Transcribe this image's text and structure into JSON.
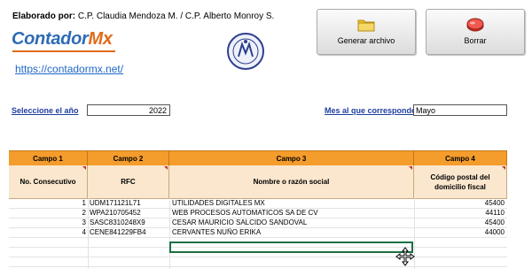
{
  "header": {
    "elaborado_label": "Elaborado por:",
    "elaborado_text": " C.P. Claudia Mendoza M. / C.P. Alberto Monroy S.",
    "logo_part1": "Contador",
    "logo_part2": "Mx",
    "link": "https://contadormx.net/"
  },
  "buttons": {
    "generate": "Generar archivo",
    "clear": "Borrar"
  },
  "filters": {
    "year_label": "Seleccione el año",
    "year_value": "2022",
    "month_label": "Mes al que corresponde",
    "month_value": "Mayo"
  },
  "table": {
    "group_headers": [
      "Campo 1",
      "Campo 2",
      "Campo 3",
      "Campo 4"
    ],
    "col_headers": [
      "No. Consecutivo",
      "RFC",
      "Nombre o razón social",
      "Código postal del domicilio fiscal"
    ],
    "rows": [
      {
        "n": "1",
        "rfc": "UDM171121L71",
        "name": "UTILIDADES DIGITALES MX",
        "cp": "45400"
      },
      {
        "n": "2",
        "rfc": "WPA210705452",
        "name": "WEB PROCESOS AUTOMATICOS SA DE CV",
        "cp": "44110"
      },
      {
        "n": "3",
        "rfc": "SASC8310248X9",
        "name": "CESAR MAURICIO SALCIDO SANDOVAL",
        "cp": "45400"
      },
      {
        "n": "4",
        "rfc": "CENE841229FB4",
        "name": "CERVANTES NUÑO ERIKA",
        "cp": "44000"
      }
    ]
  },
  "colors": {
    "header_orange": "#f49c2c",
    "header_light": "#fae7ce",
    "link_blue": "#1f67c8",
    "selection_green": "#1d6f42"
  }
}
